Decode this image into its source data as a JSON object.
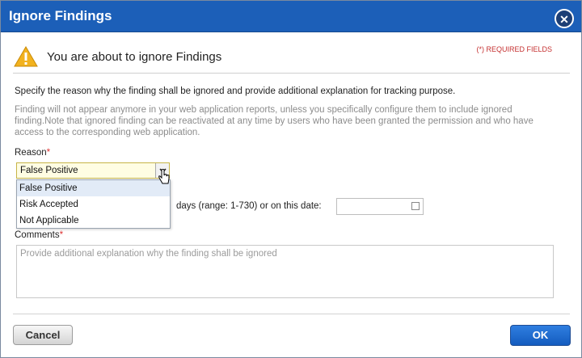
{
  "dialog": {
    "title": "Ignore Findings",
    "close_glyph": "✕",
    "heading": "You are about to ignore Findings",
    "required_note": "(*) REQUIRED FIELDS",
    "instructions": "Specify the reason why the finding shall be ignored and provide additional explanation for tracking purpose.",
    "note": "Finding will not appear anymore in your web application reports, unless you specifically configure them to include ignored finding.Note that ignored finding can be reactivated at any time by users who have been granted the permission and who have access to the corresponding web application."
  },
  "reason": {
    "label": "Reason",
    "required_mark": "*",
    "selected": "False Positive",
    "options": [
      "False Positive",
      "Risk Accepted",
      "Not Applicable"
    ]
  },
  "expiry": {
    "text": "days (range: 1-730) or on this date:",
    "date_value": ""
  },
  "comments": {
    "label": "Comments",
    "required_mark": "*",
    "placeholder": "Provide additional explanation why the finding shall be ignored"
  },
  "buttons": {
    "cancel": "Cancel",
    "ok": "OK"
  },
  "icons": {
    "warning": "warning-icon",
    "close": "close-icon",
    "dropdown": "chevron-down-icon",
    "calendar": "calendar-icon",
    "cursor": "hand-cursor-icon"
  },
  "colors": {
    "titlebar": "#1c5fb8",
    "required": "#c53030",
    "ok_button": "#1f6ed4"
  }
}
